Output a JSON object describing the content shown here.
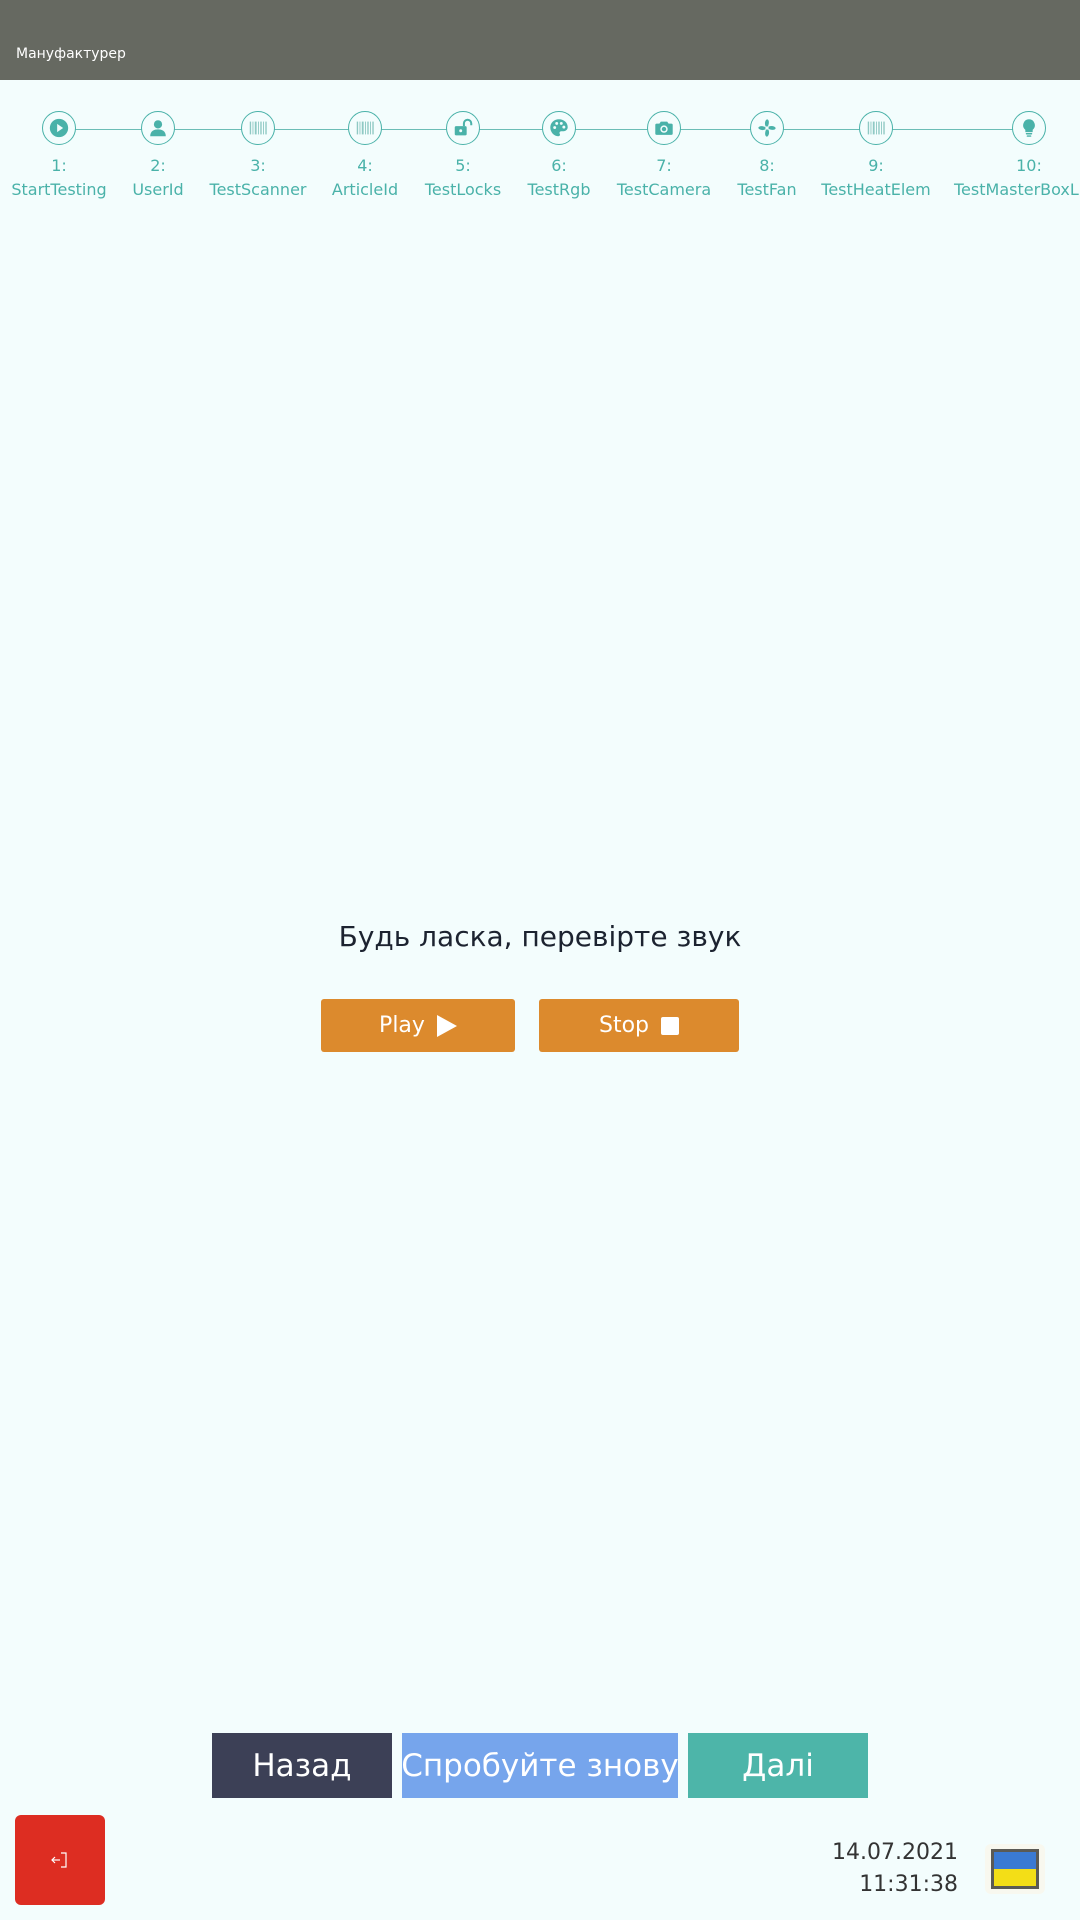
{
  "header": {
    "title": "Мануфактурер"
  },
  "stepper": {
    "steps": [
      {
        "number": "1:",
        "name": "StartTesting",
        "icon": "play-circle-icon"
      },
      {
        "number": "2:",
        "name": "UserId",
        "icon": "user-icon"
      },
      {
        "number": "3:",
        "name": "TestScanner",
        "icon": "barcode-icon"
      },
      {
        "number": "4:",
        "name": "ArticleId",
        "icon": "barcode-icon"
      },
      {
        "number": "5:",
        "name": "TestLocks",
        "icon": "unlock-icon"
      },
      {
        "number": "6:",
        "name": "TestRgb",
        "icon": "palette-icon"
      },
      {
        "number": "7:",
        "name": "TestCamera",
        "icon": "camera-icon"
      },
      {
        "number": "8:",
        "name": "TestFan",
        "icon": "fan-icon"
      },
      {
        "number": "9:",
        "name": "TestHeatElem",
        "icon": "barcode-icon"
      },
      {
        "number": "10:",
        "name": "TestMasterBoxLight",
        "icon": "lightbulb-icon"
      }
    ]
  },
  "main": {
    "prompt": "Будь ласка, перевірте звук",
    "play_label": "Play",
    "stop_label": "Stop"
  },
  "footer": {
    "back_label": "Назад",
    "retry_label": "Спробуйте знову",
    "next_label": "Далі",
    "date": "14.07.2021",
    "time": "11:31:38",
    "language_flag": "ukraine-flag-icon",
    "exit_icon": "logout-icon"
  },
  "colors": {
    "header_bg": "#666961",
    "page_bg": "#f3fdfd",
    "accent_teal": "#4ab2a9",
    "orange": "#dc8a2d",
    "back_bg": "#3c4056",
    "retry_bg": "#76a5ec",
    "next_bg": "#4db5a9",
    "exit_bg": "#dd2d22"
  }
}
